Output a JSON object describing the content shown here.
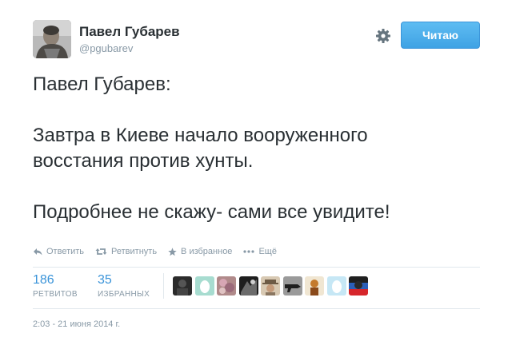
{
  "user": {
    "full_name": "Павел Губарев",
    "username": "@pgubarev"
  },
  "follow_button": {
    "label": "Читаю"
  },
  "tweet": {
    "lines": [
      "Павел Губарев:",
      "Завтра в Киеве начало вооруженного",
      "восстания против хунты.",
      "Подробнее не скажу- сами все увидите!"
    ]
  },
  "actions": {
    "reply": "Ответить",
    "retweet": "Ретвитнуть",
    "favorite": "В избранное",
    "more": "Ещё"
  },
  "stats": {
    "retweets": {
      "count": "186",
      "label": "РЕТВИТОВ"
    },
    "favorites": {
      "count": "35",
      "label": "ИЗБРАННЫХ"
    }
  },
  "favoriter_avatars": [
    {
      "icon": "avatar-dark-figure"
    },
    {
      "icon": "avatar-default-egg"
    },
    {
      "icon": "avatar-flowers"
    },
    {
      "icon": "avatar-dark-scene"
    },
    {
      "icon": "avatar-man-hat"
    },
    {
      "icon": "avatar-gun"
    },
    {
      "icon": "avatar-cartoon"
    },
    {
      "icon": "avatar-default-egg"
    },
    {
      "icon": "avatar-flag-face"
    }
  ],
  "timestamp": "2:03 - 21 июня 2014 г.",
  "colors": {
    "link_blue": "#3b94d9",
    "muted": "#8899a6",
    "button_blue": "#55b6ef",
    "text": "#292f33",
    "divider": "#e1e8ed"
  }
}
